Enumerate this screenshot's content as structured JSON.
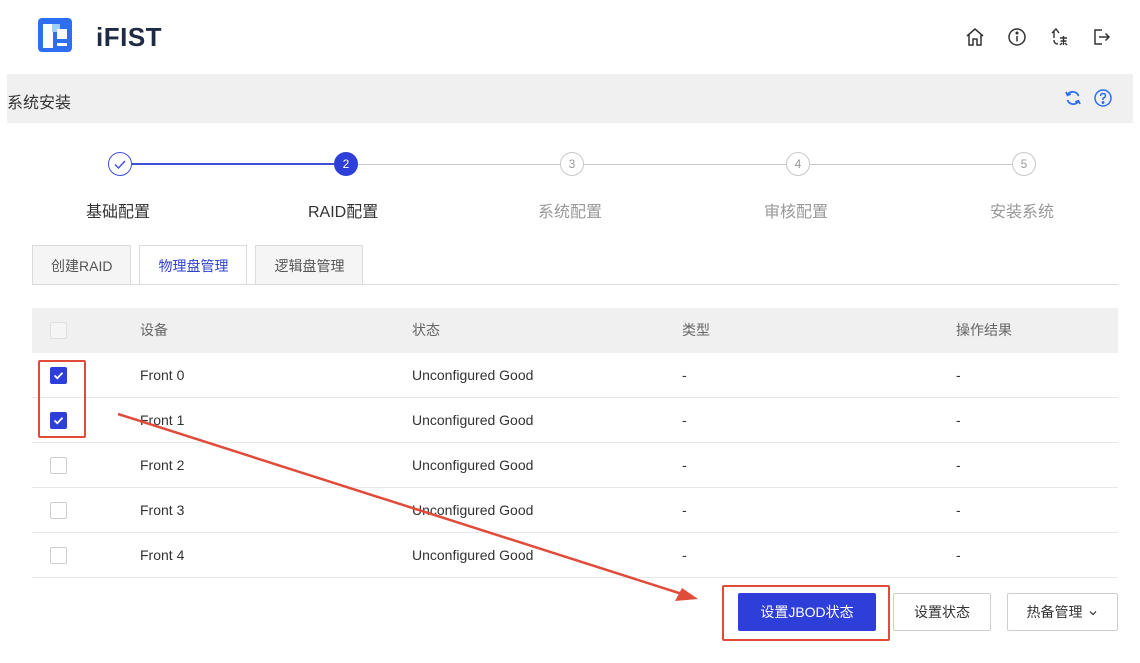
{
  "app": {
    "brand": "iFIST"
  },
  "header_icons": [
    "home-icon",
    "info-icon",
    "language-icon",
    "logout-icon"
  ],
  "page": {
    "title": "系统安装"
  },
  "steps": [
    {
      "number": "1",
      "label": "基础配置",
      "state": "done"
    },
    {
      "number": "2",
      "label": "RAID配置",
      "state": "active"
    },
    {
      "number": "3",
      "label": "系统配置",
      "state": "todo"
    },
    {
      "number": "4",
      "label": "审核配置",
      "state": "todo"
    },
    {
      "number": "5",
      "label": "安装系统",
      "state": "todo"
    }
  ],
  "tabs": [
    {
      "label": "创建RAID",
      "active": false
    },
    {
      "label": "物理盘管理",
      "active": true
    },
    {
      "label": "逻辑盘管理",
      "active": false
    }
  ],
  "table": {
    "columns": [
      "设备",
      "状态",
      "类型",
      "操作结果"
    ],
    "rows": [
      {
        "device": "Front 0",
        "state": "Unconfigured Good",
        "type": "-",
        "result": "-",
        "checked": true
      },
      {
        "device": "Front 1",
        "state": "Unconfigured Good",
        "type": "-",
        "result": "-",
        "checked": true
      },
      {
        "device": "Front 2",
        "state": "Unconfigured Good",
        "type": "-",
        "result": "-",
        "checked": false
      },
      {
        "device": "Front 3",
        "state": "Unconfigured Good",
        "type": "-",
        "result": "-",
        "checked": false
      },
      {
        "device": "Front 4",
        "state": "Unconfigured Good",
        "type": "-",
        "result": "-",
        "checked": false
      }
    ]
  },
  "actions": {
    "set_jbod": "设置JBOD状态",
    "set_state": "设置状态",
    "hotspare": "热备管理"
  },
  "colors": {
    "primary": "#2d3fd8",
    "highlight": "#e04b3a"
  }
}
